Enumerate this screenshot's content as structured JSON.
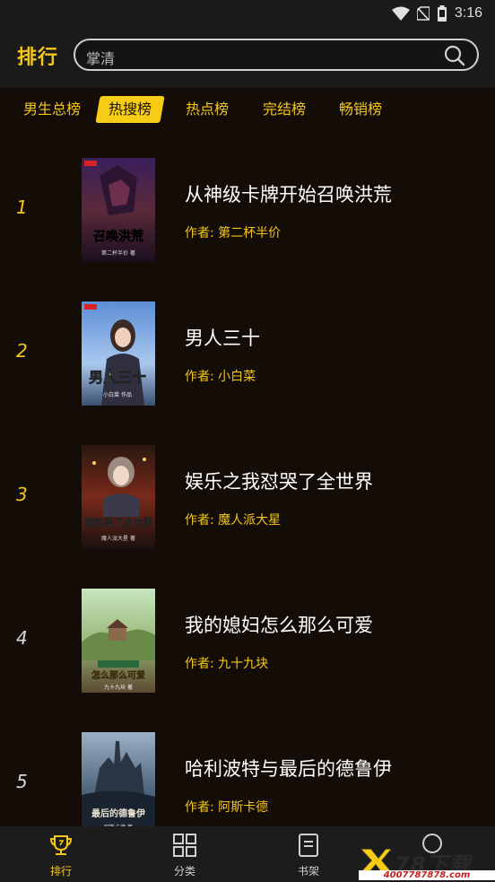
{
  "status_bar": {
    "time": "3:16"
  },
  "header": {
    "title": "排行",
    "search_placeholder": "掌清"
  },
  "tabs": [
    {
      "label": "男生总榜",
      "active": false
    },
    {
      "label": "热搜榜",
      "active": true
    },
    {
      "label": "热点榜",
      "active": false
    },
    {
      "label": "完结榜",
      "active": false
    },
    {
      "label": "畅销榜",
      "active": false
    }
  ],
  "books": [
    {
      "rank": "1",
      "title": "从神级卡牌开始召唤洪荒",
      "author": "作者: 第二杯半价",
      "cover_text": "召唤洪荒",
      "cover_sub": "第二杯半价 著"
    },
    {
      "rank": "2",
      "title": "男人三十",
      "author": "作者: 小白菜",
      "cover_text": "男人三十",
      "cover_sub": "小白菜 作品"
    },
    {
      "rank": "3",
      "title": "娱乐之我怼哭了全世界",
      "author": "作者: 魔人派大星",
      "cover_text": "我怼哭了全世界",
      "cover_sub": "魔人派大星 著"
    },
    {
      "rank": "4",
      "title": "我的媳妇怎么那么可爱",
      "author": "作者: 九十九块",
      "cover_text": "怎么那么可爱",
      "cover_sub": "九十九块 著"
    },
    {
      "rank": "5",
      "title": "哈利波特与最后的德鲁伊",
      "author": "作者: 阿斯卡德",
      "cover_text": "最后的德鲁伊",
      "cover_sub": "阿斯卡德 著"
    }
  ],
  "bottom_nav": [
    {
      "label": "排行",
      "icon": "trophy-icon",
      "active": true
    },
    {
      "label": "分类",
      "icon": "grid-icon",
      "active": false
    },
    {
      "label": "书架",
      "icon": "bookshelf-icon",
      "active": false
    },
    {
      "label": "",
      "icon": "user-icon",
      "active": false
    }
  ],
  "watermark": {
    "brand": "78下载",
    "url": "4007787878.com"
  },
  "colors": {
    "accent": "#f3c81a",
    "background": "#140c06",
    "header": "#1a1a1a",
    "rank_top": "#f3c81a",
    "rank_rest": "#d8d8d8"
  }
}
